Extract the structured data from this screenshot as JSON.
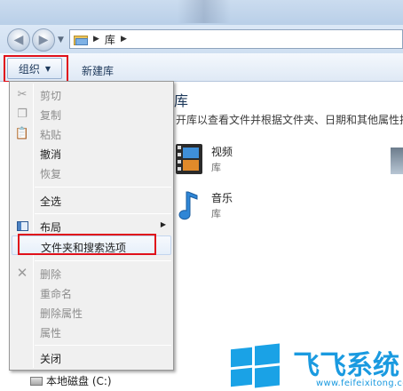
{
  "address": {
    "crumbs": [
      "库"
    ]
  },
  "toolbar": {
    "organize_label": "组织",
    "new_library_label": "新建库"
  },
  "content": {
    "title_partial": "库",
    "description": "开库以查看文件并根据文件夹、日期和其他属性排",
    "libraries": [
      {
        "name": "视频",
        "type": "库"
      },
      {
        "name": "音乐",
        "type": "库"
      }
    ]
  },
  "menu": {
    "items": [
      {
        "label": "剪切",
        "enabled": false,
        "icon": "scissors-icon"
      },
      {
        "label": "复制",
        "enabled": false,
        "icon": "copy-icon"
      },
      {
        "label": "粘贴",
        "enabled": false,
        "icon": "paste-icon"
      },
      {
        "label": "撤消",
        "enabled": true
      },
      {
        "label": "恢复",
        "enabled": false
      },
      {
        "label": "全选",
        "enabled": true
      },
      {
        "label": "布局",
        "enabled": true,
        "icon": "layout-icon",
        "submenu": true
      },
      {
        "label": "文件夹和搜索选项",
        "enabled": true
      },
      {
        "label": "删除",
        "enabled": false,
        "icon": "delete-x-icon"
      },
      {
        "label": "重命名",
        "enabled": false
      },
      {
        "label": "删除属性",
        "enabled": false
      },
      {
        "label": "属性",
        "enabled": false
      },
      {
        "label": "关闭",
        "enabled": true
      }
    ]
  },
  "navtree": {
    "drive_label": "本地磁盘 (C:)"
  },
  "watermark": {
    "name": "飞飞系统",
    "url": "www.feifeixitong.com"
  },
  "colors": {
    "highlight_red": "#e0101a",
    "watermark_blue": "#1a9ae0"
  }
}
